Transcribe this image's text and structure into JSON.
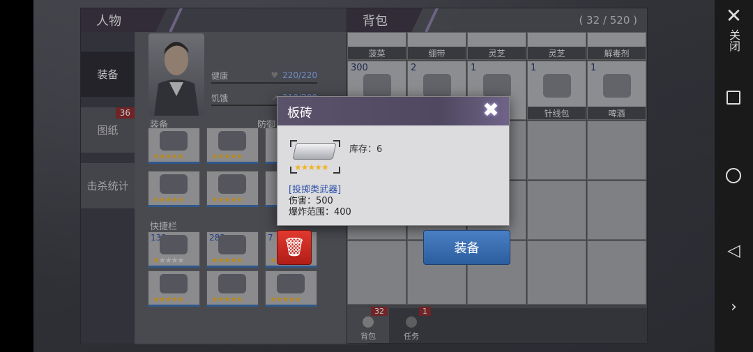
{
  "character_panel": {
    "title": "人物",
    "tabs": [
      {
        "label": "装备",
        "badge": ""
      },
      {
        "label": "图纸",
        "badge": "36"
      },
      {
        "label": "击杀统计",
        "badge": ""
      }
    ],
    "stats": [
      {
        "label": "健康",
        "value": "220/220",
        "icon": "heart-icon"
      },
      {
        "label": "饥饿",
        "value": "210/200",
        "icon": "food-icon"
      }
    ],
    "equip_label": "装备",
    "defense_label": "防御",
    "quickbar_label": "快捷栏",
    "equip_slots": [
      {
        "icon": "helmet-icon",
        "stars": 5
      },
      {
        "icon": "armor-icon",
        "stars": 5
      },
      {
        "icon": "gloves-icon",
        "stars": 5
      },
      {
        "icon": "pants-icon",
        "stars": 5
      }
    ],
    "quick_slots": [
      {
        "count": "133",
        "icon": "spear-icon",
        "stars": 1
      },
      {
        "count": "283",
        "icon": "ammo-icon",
        "stars": 5
      },
      {
        "count": "7",
        "icon": "weapon-icon",
        "stars": 5
      },
      {
        "count": "",
        "icon": "crossbow-icon",
        "stars": 5
      },
      {
        "count": "",
        "icon": "rifle-icon",
        "stars": 5
      },
      {
        "count": "",
        "icon": "shotgun-icon",
        "stars": 5
      }
    ]
  },
  "bag_panel": {
    "title": "背包",
    "capacity": "( 32 / 520 )",
    "row1": [
      "菠菜",
      "绷带",
      "灵芝",
      "灵芝",
      "解毒剂"
    ],
    "row2": [
      {
        "qty": "300",
        "name": "",
        "icon": "coin-icon"
      },
      {
        "qty": "2",
        "name": "",
        "icon": "book-icon"
      },
      {
        "qty": "1",
        "name": "",
        "icon": "scroll-icon"
      },
      {
        "qty": "1",
        "name": "针线包",
        "icon": "sewing-kit-icon"
      },
      {
        "qty": "1",
        "name": "啤酒",
        "icon": "beer-icon"
      }
    ],
    "bottom_tabs": [
      {
        "label": "背包",
        "badge": "32",
        "icon": "backpack-icon"
      },
      {
        "label": "任务",
        "badge": "1",
        "icon": "key-icon"
      }
    ]
  },
  "popup": {
    "title": "板砖",
    "stock": "库存：6",
    "type": "[投掷类武器]",
    "damage": "伤害：500",
    "range": "爆炸范围：400",
    "stars": 5,
    "icon": "brick-icon"
  },
  "actions": {
    "equip_label": "装备",
    "delete_icon": "trash-icon"
  },
  "system_bar": {
    "close_label": "关闭",
    "close_icon": "close-icon",
    "icons": [
      "square-icon",
      "circle-icon",
      "back-triangle-icon",
      "chevron-right-icon"
    ]
  },
  "colors": {
    "accent_blue": "#3a6fb2",
    "star": "#f1b320",
    "badge_red": "#8f2a2a",
    "delete_red": "#c8281f"
  }
}
